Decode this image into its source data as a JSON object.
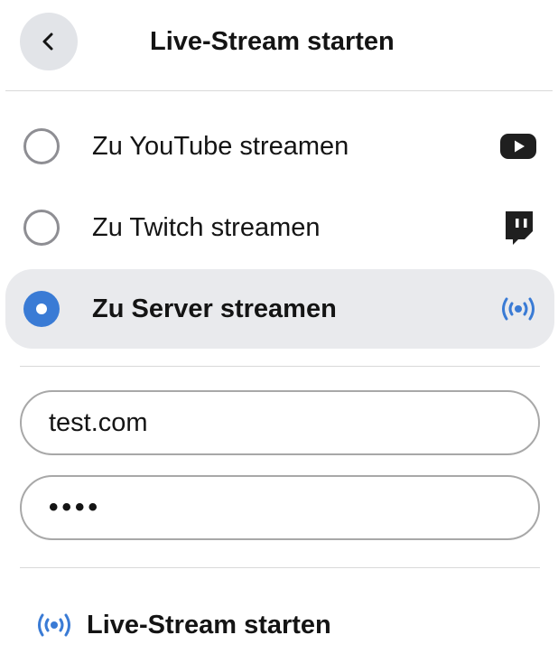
{
  "header": {
    "back_icon": "chevron-left-icon",
    "title": "Live-Stream starten"
  },
  "options": [
    {
      "label": "Zu YouTube streamen",
      "icon": "youtube-icon",
      "selected": false
    },
    {
      "label": "Zu Twitch streamen",
      "icon": "twitch-icon",
      "selected": false
    },
    {
      "label": "Zu Server streamen",
      "icon": "broadcast-icon",
      "selected": true
    }
  ],
  "server": {
    "url_value": "test.com",
    "key_value_masked": "••••"
  },
  "action": {
    "icon": "broadcast-icon",
    "label": "Live-Stream starten"
  },
  "colors": {
    "accent": "#3a7bd5",
    "selected_bg": "#e9eaed",
    "back_button_bg": "#e2e4e8",
    "border": "#a8a8a8",
    "icon_dark": "#1f1f1f"
  }
}
